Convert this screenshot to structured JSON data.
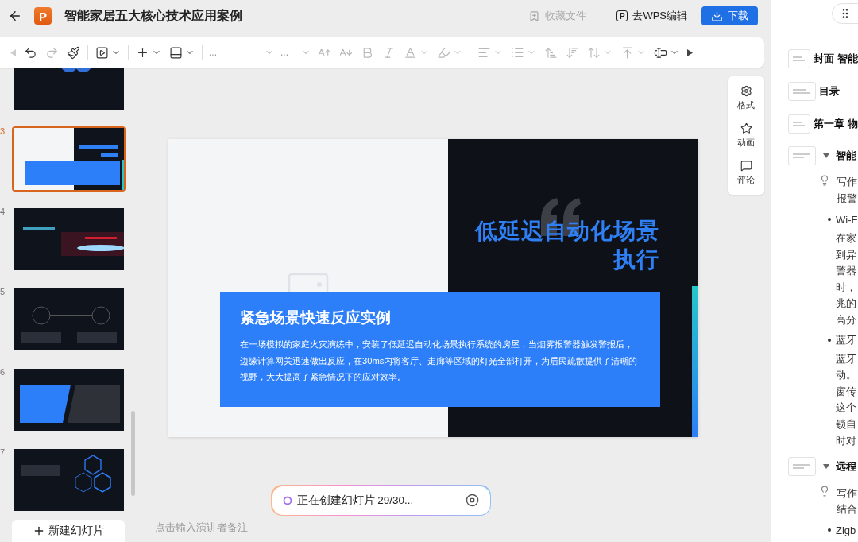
{
  "window": {
    "logo": "P",
    "title": "智能家居五大核心技术应用案例"
  },
  "header_actions": [
    {
      "kind": "favorite",
      "label": "收藏文件",
      "disabled": true
    },
    {
      "kind": "wps",
      "label": "去WPS编辑",
      "icon_letter": "P",
      "disabled": false
    },
    {
      "kind": "download",
      "label": "下载",
      "disabled": false
    }
  ],
  "toolbar": [
    {
      "kind": "prev",
      "disabled": true
    },
    {
      "kind": "undo",
      "disabled": false
    },
    {
      "kind": "redo",
      "disabled": true
    },
    {
      "kind": "painter",
      "disabled": false
    },
    {
      "kind": "sep"
    },
    {
      "kind": "play",
      "disabled": false,
      "menu": true
    },
    {
      "kind": "sep"
    },
    {
      "kind": "plus",
      "disabled": false,
      "menu": true
    },
    {
      "kind": "layout",
      "disabled": false,
      "menu": true
    },
    {
      "kind": "sep"
    },
    {
      "kind": "font",
      "value": "...",
      "disabled": true
    },
    {
      "kind": "size",
      "value": "...",
      "disabled": true
    },
    {
      "kind": "grow",
      "disabled": true
    },
    {
      "kind": "shrink",
      "disabled": true
    },
    {
      "kind": "bold",
      "disabled": true
    },
    {
      "kind": "italic",
      "disabled": true
    },
    {
      "kind": "color",
      "disabled": true,
      "menu": true
    },
    {
      "kind": "highlight",
      "disabled": true,
      "menu": true
    },
    {
      "kind": "sep"
    },
    {
      "kind": "align",
      "disabled": true,
      "menu": true
    },
    {
      "kind": "list",
      "disabled": true,
      "menu": true
    },
    {
      "kind": "spacing_up",
      "disabled": true
    },
    {
      "kind": "spacing_down",
      "disabled": true
    },
    {
      "kind": "line_spacing",
      "disabled": true,
      "menu": true
    },
    {
      "kind": "valign",
      "disabled": true,
      "menu": true
    },
    {
      "kind": "textbox",
      "disabled": false,
      "menu": true
    },
    {
      "kind": "next",
      "disabled": false
    }
  ],
  "slides": [
    {
      "kind": "cards",
      "selected": false
    },
    {
      "number": "3",
      "kind": "split",
      "selected": true
    },
    {
      "number": "4",
      "kind": "hero",
      "selected": false
    },
    {
      "number": "5",
      "kind": "timeline",
      "selected": false
    },
    {
      "number": "6",
      "kind": "panels",
      "selected": false
    },
    {
      "number": "7",
      "kind": "hexes",
      "selected": false
    }
  ],
  "new_slide_button": "新建幻灯片",
  "slide": {
    "title": "低延迟自动化场景执行",
    "card_title": "紧急场景快速反应实例",
    "card_text": "在一场模拟的家庭火灾演练中，安装了低延迟自动化场景执行系统的房屋，当烟雾报警器触发警报后，边缘计算网关迅速做出反应，在30ms内将客厅、走廊等区域的灯光全部打开，为居民疏散提供了清晰的视野，大大提高了紧急情况下的应对效率。"
  },
  "side_tools": [
    {
      "kind": "format",
      "label": "格式"
    },
    {
      "kind": "animation",
      "label": "动画"
    },
    {
      "kind": "comment",
      "label": "评论"
    }
  ],
  "progress": {
    "text": "正在创建幻灯片 29/30..."
  },
  "notes": {
    "placeholder": "点击输入演讲者备注"
  },
  "outline": [
    {
      "kind": "slide",
      "title": "封面 智能"
    },
    {
      "kind": "slide",
      "title": "目录"
    },
    {
      "kind": "slide",
      "title": "第一章 物"
    },
    {
      "kind": "section",
      "title": "智能",
      "expanded": true,
      "items": [
        {
          "kind": "prompt",
          "lines": [
            "写作",
            "报警"
          ]
        },
        {
          "kind": "bullet",
          "title": "Wi-F",
          "lines": [
            "在家",
            "到异",
            "警器",
            "时，",
            "兆的",
            "高分"
          ]
        },
        {
          "kind": "bullet",
          "title": "蓝牙",
          "lines": [
            "蓝牙",
            "动。",
            "窗传",
            "这个",
            "锁自",
            "时对"
          ]
        }
      ]
    },
    {
      "kind": "section",
      "title": "远程",
      "expanded": true,
      "items": [
        {
          "kind": "prompt",
          "lines": [
            "写作",
            "结合"
          ]
        },
        {
          "kind": "bullet",
          "title": "Zigb"
        }
      ]
    }
  ]
}
